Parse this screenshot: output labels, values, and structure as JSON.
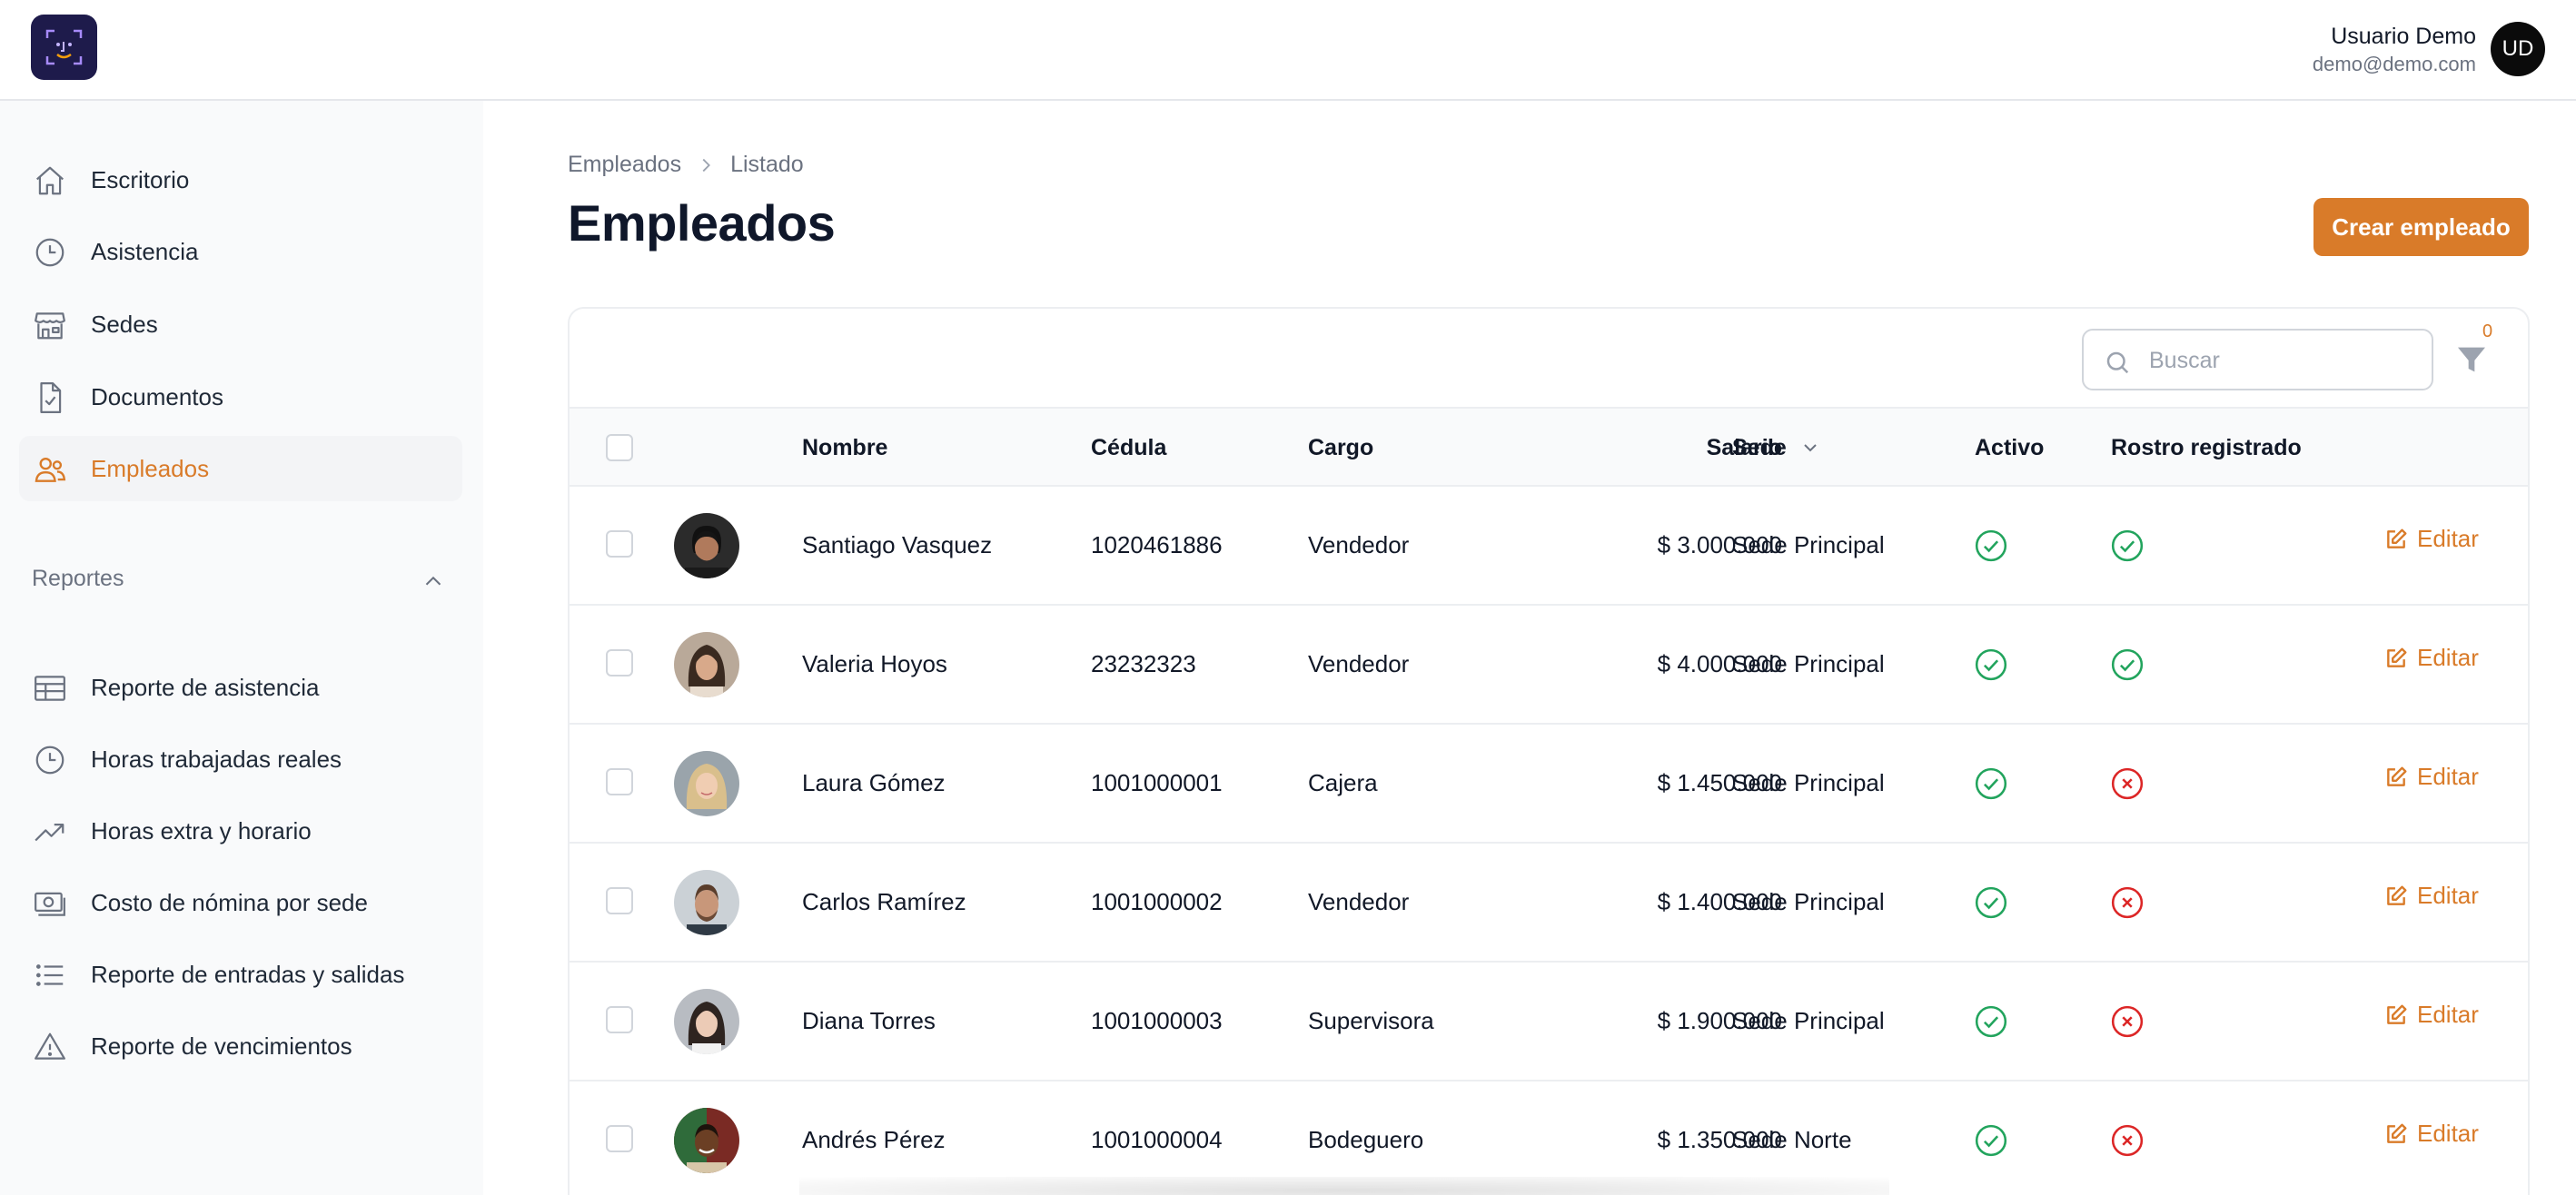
{
  "header": {
    "user_name": "Usuario Demo",
    "user_email": "demo@demo.com",
    "user_initials": "UD"
  },
  "sidebar": {
    "items": [
      {
        "label": "Escritorio",
        "icon": "home-icon"
      },
      {
        "label": "Asistencia",
        "icon": "clock-icon"
      },
      {
        "label": "Sedes",
        "icon": "store-icon"
      },
      {
        "label": "Documentos",
        "icon": "document-check-icon"
      },
      {
        "label": "Empleados",
        "icon": "users-icon",
        "active": true
      }
    ],
    "reports_section": {
      "label": "Reportes",
      "items": [
        {
          "label": "Reporte de asistencia",
          "icon": "table-icon"
        },
        {
          "label": "Horas trabajadas reales",
          "icon": "clock-icon"
        },
        {
          "label": "Horas extra y horario",
          "icon": "trending-up-icon"
        },
        {
          "label": "Costo de nómina por sede",
          "icon": "cash-icon"
        },
        {
          "label": "Reporte de entradas y salidas",
          "icon": "list-icon"
        },
        {
          "label": "Reporte de vencimientos",
          "icon": "warning-icon"
        }
      ]
    }
  },
  "breadcrumb": {
    "items": [
      "Empleados",
      "Listado"
    ]
  },
  "page": {
    "title": "Empleados",
    "create_button": "Crear empleado"
  },
  "table_toolbar": {
    "search_placeholder": "Buscar",
    "filter_count": "0"
  },
  "table": {
    "columns": {
      "nombre": "Nombre",
      "cedula": "Cédula",
      "cargo": "Cargo",
      "salario": "Salario",
      "sede": "Sede",
      "activo": "Activo",
      "rostro": "Rostro registrado"
    },
    "edit_label": "Editar",
    "rows": [
      {
        "nombre": "Santiago Vasquez",
        "cedula": "1020461886",
        "cargo": "Vendedor",
        "salario": "$ 3.000.000",
        "sede": "Sede Principal",
        "activo": true,
        "rostro": true
      },
      {
        "nombre": "Valeria Hoyos",
        "cedula": "23232323",
        "cargo": "Vendedor",
        "salario": "$ 4.000.000",
        "sede": "Sede Principal",
        "activo": true,
        "rostro": true
      },
      {
        "nombre": "Laura Gómez",
        "cedula": "1001000001",
        "cargo": "Cajera",
        "salario": "$ 1.450.000",
        "sede": "Sede Principal",
        "activo": true,
        "rostro": false
      },
      {
        "nombre": "Carlos Ramírez",
        "cedula": "1001000002",
        "cargo": "Vendedor",
        "salario": "$ 1.400.000",
        "sede": "Sede Principal",
        "activo": true,
        "rostro": false
      },
      {
        "nombre": "Diana Torres",
        "cedula": "1001000003",
        "cargo": "Supervisora",
        "salario": "$ 1.900.000",
        "sede": "Sede Principal",
        "activo": true,
        "rostro": false
      },
      {
        "nombre": "Andrés Pérez",
        "cedula": "1001000004",
        "cargo": "Bodeguero",
        "salario": "$ 1.350.000",
        "sede": "Sede Norte",
        "activo": true,
        "rostro": false
      }
    ]
  },
  "colors": {
    "accent": "#d97b29",
    "success": "#22a45d",
    "danger": "#dc2626"
  }
}
